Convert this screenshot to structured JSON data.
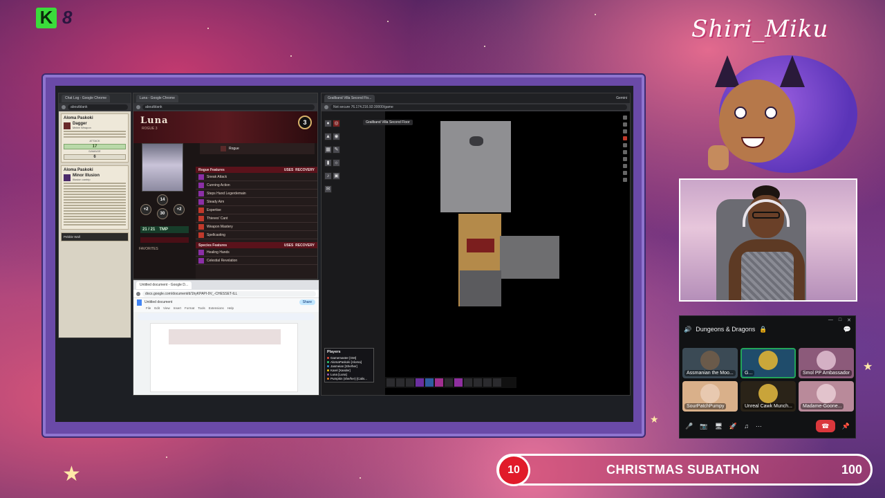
{
  "overlay": {
    "logo_letter": "K",
    "logo_number": "8",
    "streamer_name": "Shiri_Miku",
    "subathon": {
      "current": "10",
      "title": "CHRISTMAS SUBATHON",
      "goal": "100"
    }
  },
  "chat_window": {
    "tab": "Chat Log - Google Chrome",
    "url": "aboutblank",
    "cards": [
      {
        "name": "Aloma Paskoki",
        "item": "Dagger",
        "desc": "Melee Weapon",
        "attack_label": "ATTACK",
        "attack_value": "17",
        "damage_label": "DAMAGE",
        "damage_value": "6"
      },
      {
        "name": "Aloma Paskoki",
        "item": "Minor Illusion",
        "desc": "Illusion cantrip",
        "footer": "Pebble Wall"
      }
    ]
  },
  "sheet_window": {
    "tab": "Luna - Google Chrome",
    "url": "aboutblank",
    "name": "Luna",
    "class": "ROGUE 3",
    "level": "3",
    "hp_label": "21 / 21",
    "hp_temp": "TMP",
    "favorites": "FAVORITES",
    "weapon": "Rogue",
    "features_header": "Rogue Features",
    "uses_label": "USES",
    "recovery_label": "RECOVERY",
    "features": [
      "Sneak Attack",
      "Cunning Action",
      "Steps Hand Legerdemain",
      "Steady Aim",
      "Expertise",
      "Thieves' Cant",
      "Weapon Mastery",
      "Spellcasting"
    ],
    "species_header": "Species Features",
    "species": [
      "Healing Hands",
      "Celestial Revelation"
    ],
    "stats": {
      "ac": "14",
      "init": "+2",
      "speed": "30",
      "prof": "+2"
    }
  },
  "doc_window": {
    "tab": "Untitled document - Google D...",
    "url": "docs.google.com/document/d/1hyKPAPI-9V_-CHESSET-ILL",
    "title": "Untitled document",
    "menu": [
      "File",
      "Edit",
      "View",
      "Insert",
      "Format",
      "Tools",
      "Extensions",
      "Help"
    ],
    "share": "Share"
  },
  "vtt_window": {
    "tab": "Grailband Villa Second Flo...",
    "url": "Not secure  76.174.216.92:30000/game",
    "profile": "Gemini",
    "scene": "Grailband Villa Second Floor",
    "players_title": "Players",
    "players": [
      {
        "name": "Gamemaster [GM]",
        "color": "#e74c3c"
      },
      {
        "name": "AlomaPaskoki [Aloma]",
        "color": "#2ecc71"
      },
      {
        "name": "Jasmeian [She/her]",
        "color": "#3498db"
      },
      {
        "name": "Karel [Xander]",
        "color": "#f1c40f"
      },
      {
        "name": "Luna [Luna]",
        "color": "#9b59b6"
      },
      {
        "name": "Pumpkin (she/her) [Calis...",
        "color": "#e67e22"
      }
    ]
  },
  "discord": {
    "channel": "Dungeons & Dragons",
    "participants": [
      {
        "name": "Assmanian the Moo...",
        "color": "#3b4a55"
      },
      {
        "name": "G...",
        "color": "#1f4c6b"
      },
      {
        "name": "Smol PP Ambassador",
        "color": "#8c5a7a"
      },
      {
        "name": "SourPatchPumpy",
        "color": "#d9b08a"
      },
      {
        "name": "Unreal Cawk Munch...",
        "color": "#2a2318"
      },
      {
        "name": "Madame-Goone...",
        "color": "#b98a9a"
      }
    ]
  },
  "colors": {
    "frame": "#6a4aa8",
    "subathon_red": "#e11b2a",
    "hangup": "#da373c"
  }
}
